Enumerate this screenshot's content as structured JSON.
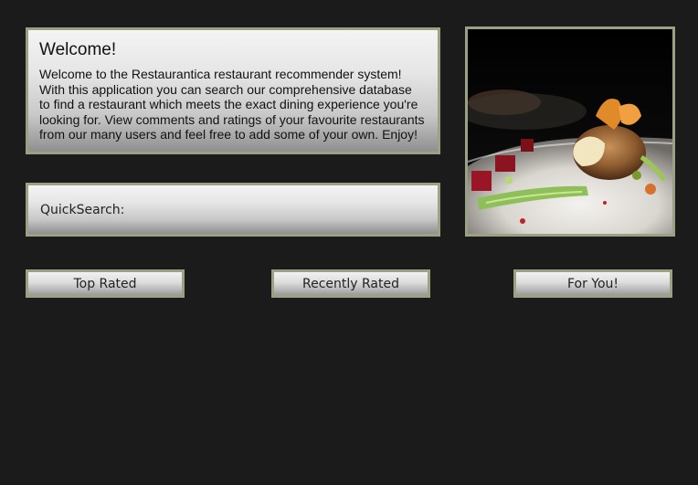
{
  "welcome": {
    "title": "Welcome!",
    "text": "Welcome to the Restaurantica restaurant recommender system!\nWith this application you can search our comprehensive database\nto find a restaurant which meets the exact dining experience you're\nlooking for. View comments and ratings of your favourite restaurants\nfrom our many users and feel free to add some of your own. Enjoy!"
  },
  "quicksearch": {
    "label": "QuickSearch:",
    "value": "",
    "placeholder": ""
  },
  "buttons": {
    "top_rated": "Top Rated",
    "recently_rated": "Recently Rated",
    "for_you": "For You!"
  },
  "colors": {
    "background": "#1b1b1b",
    "border": "#9ba283"
  }
}
